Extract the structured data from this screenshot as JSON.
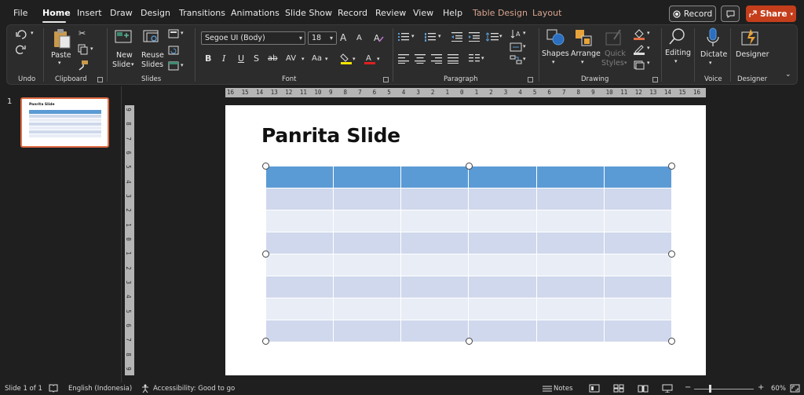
{
  "menu": {
    "tabs": [
      {
        "label": "File"
      },
      {
        "label": "Home"
      },
      {
        "label": "Insert"
      },
      {
        "label": "Draw"
      },
      {
        "label": "Design"
      },
      {
        "label": "Transitions"
      },
      {
        "label": "Animations"
      },
      {
        "label": "Slide Show"
      },
      {
        "label": "Record"
      },
      {
        "label": "Review"
      },
      {
        "label": "View"
      },
      {
        "label": "Help"
      },
      {
        "label": "Table Design"
      },
      {
        "label": "Layout"
      }
    ],
    "active_tab": "Home",
    "record_label": "Record",
    "share_label": "Share",
    "share_color": "#c43e1c",
    "contextual_tab_color": "#d7a48e"
  },
  "ribbon": {
    "groups": {
      "undo": "Undo",
      "clipboard": "Clipboard",
      "slides": "Slides",
      "font": "Font",
      "paragraph": "Paragraph",
      "drawing": "Drawing",
      "voice": "Voice",
      "designer": "Designer"
    },
    "buttons": {
      "paste": "Paste",
      "new_slide_1": "New",
      "new_slide_2": "Slide",
      "reuse_1": "Reuse",
      "reuse_2": "Slides",
      "shapes": "Shapes",
      "arrange": "Arrange",
      "quick_styles_1": "Quick",
      "quick_styles_2": "Styles",
      "editing": "Editing",
      "dictate": "Dictate",
      "designer": "Designer"
    },
    "font_name": "Segoe UI (Body)",
    "font_size": "18",
    "format_buttons": [
      "B",
      "I",
      "U",
      "S",
      "ab",
      "AV",
      "Aa"
    ],
    "grow_font": "A",
    "shrink_font": "A"
  },
  "thumbnail": {
    "number": "1",
    "title": "Panrita Slide"
  },
  "ruler": {
    "horizontal": [
      "16",
      "15",
      "14",
      "13",
      "12",
      "11",
      "10",
      "9",
      "8",
      "7",
      "6",
      "5",
      "4",
      "3",
      "2",
      "1",
      "0",
      "1",
      "2",
      "3",
      "4",
      "5",
      "6",
      "7",
      "8",
      "9",
      "10",
      "11",
      "12",
      "13",
      "14",
      "15",
      "16"
    ],
    "vertical": [
      "9",
      "8",
      "7",
      "6",
      "5",
      "4",
      "3",
      "2",
      "1",
      "0",
      "1",
      "2",
      "3",
      "4",
      "5",
      "6",
      "7",
      "8",
      "9"
    ]
  },
  "slide": {
    "title": "Panrita Slide",
    "table": {
      "columns": 6,
      "rows": 8,
      "header_color": "#5b9bd5",
      "band_color_1": "#cfd8ec",
      "band_color_2": "#e8edf6"
    }
  },
  "status": {
    "slide_counter": "Slide 1 of 1",
    "language": "English (Indonesia)",
    "accessibility": "Accessibility: Good to go",
    "notes": "Notes",
    "zoom": "60%"
  }
}
